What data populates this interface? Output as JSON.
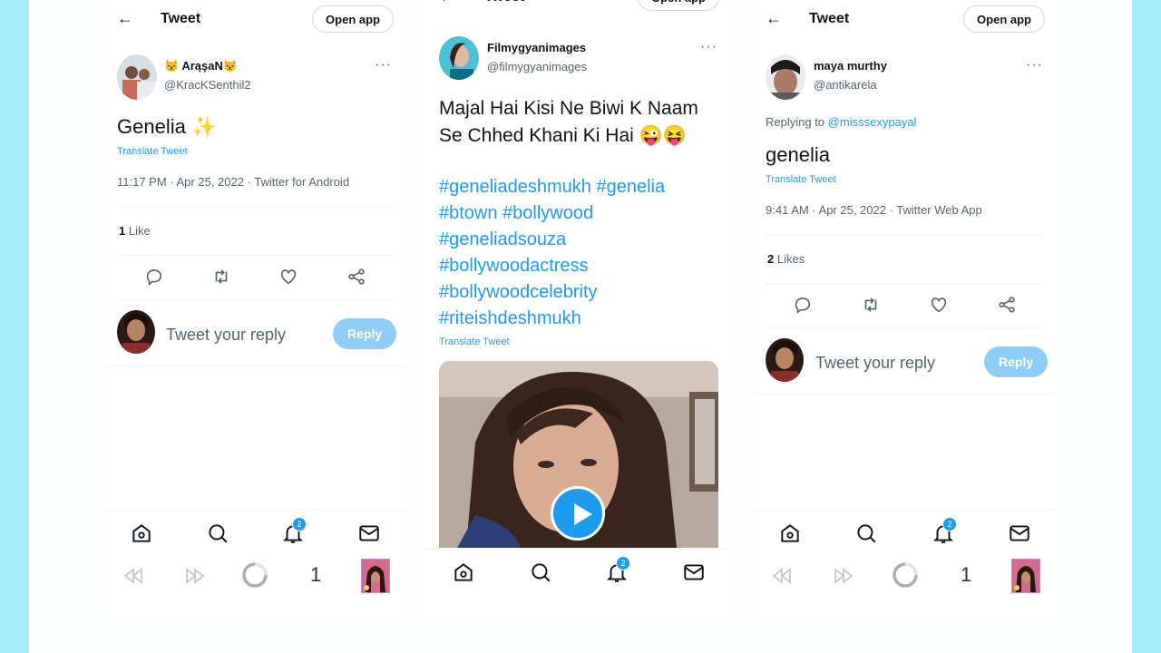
{
  "header": {
    "title": "Tweet",
    "open_app": "Open app"
  },
  "panel1": {
    "name": "😾 ArąşaN😾",
    "handle": "@KracKSenthil2",
    "text": "Genelia ✨",
    "translate": "Translate Tweet",
    "meta": "11:17 PM · Apr 25, 2022 · Twitter for Android",
    "likes_count": "1",
    "likes_label": "Like",
    "reply_placeholder": "Tweet your reply",
    "reply_button": "Reply",
    "notif_badge": "2",
    "media_counter": "1"
  },
  "panel2": {
    "name": "Filmygyanimages",
    "handle": "@filmygyanimages",
    "text": "Majal Hai Kisi Ne Biwi K Naam Se Chhed Khani Ki Hai 😜😝",
    "hashtags": [
      "#geneliadeshmukh #genelia",
      "#btown #bollywood",
      "#geneliadsouza",
      "#bollywoodactress",
      "#bollywoodcelebrity",
      "#riteishdeshmukh"
    ],
    "translate": "Translate Tweet",
    "notif_badge": "2"
  },
  "panel3": {
    "name": "maya murthy",
    "handle": "@antikarela",
    "replying_prefix": "Replying to",
    "replying_to": "@misssexypayal",
    "text": "genelia",
    "translate": "Translate Tweet",
    "meta": "9:41 AM · Apr 25, 2022 · Twitter Web App",
    "likes_count": "2",
    "likes_label": "Likes",
    "reply_placeholder": "Tweet your reply",
    "reply_button": "Reply",
    "notif_badge": "2",
    "media_counter": "1"
  },
  "colors": {
    "accent": "#1d9bf0",
    "reply_disabled": "#8ecdf8",
    "backdrop": "#a6ecfb"
  }
}
